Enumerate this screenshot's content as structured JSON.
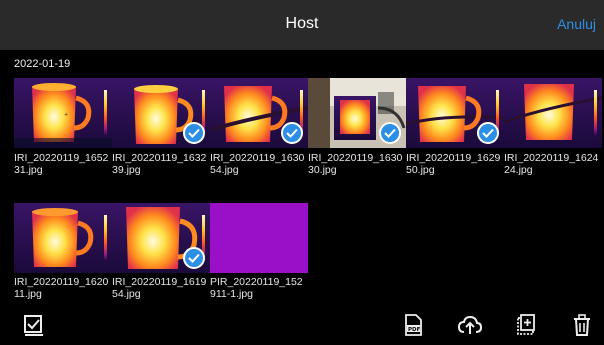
{
  "header": {
    "title": "Host",
    "cancel_label": "Anuluj"
  },
  "gallery": {
    "date": "2022-01-19",
    "items": [
      {
        "name": "IRI_20220119_165231.jpg",
        "kind": "thermal",
        "selected": false
      },
      {
        "name": "IRI_20220119_163239.jpg",
        "kind": "thermal",
        "selected": true
      },
      {
        "name": "IRI_20220119_163054.jpg",
        "kind": "thermal",
        "selected": true
      },
      {
        "name": "IRI_20220119_163030.jpg",
        "kind": "photo-overlay",
        "selected": true
      },
      {
        "name": "IRI_20220119_162950.jpg",
        "kind": "thermal",
        "selected": true
      },
      {
        "name": "IRI_20220119_162424.jpg",
        "kind": "thermal",
        "selected": false
      },
      {
        "name": "IRI_20220119_162011.jpg",
        "kind": "thermal",
        "selected": false
      },
      {
        "name": "IRI_20220119_161954.jpg",
        "kind": "thermal",
        "selected": true
      },
      {
        "name": "PIR_20220119_152911-1.jpg",
        "kind": "purple",
        "selected": false
      }
    ]
  },
  "toolbar": {
    "icons": [
      "select-all-icon",
      "pdf-icon",
      "upload-cloud-icon",
      "add-copy-icon",
      "delete-icon"
    ]
  },
  "colors": {
    "header_bg": "#2a2a2a",
    "accent": "#2f8de4",
    "background": "#000000"
  }
}
